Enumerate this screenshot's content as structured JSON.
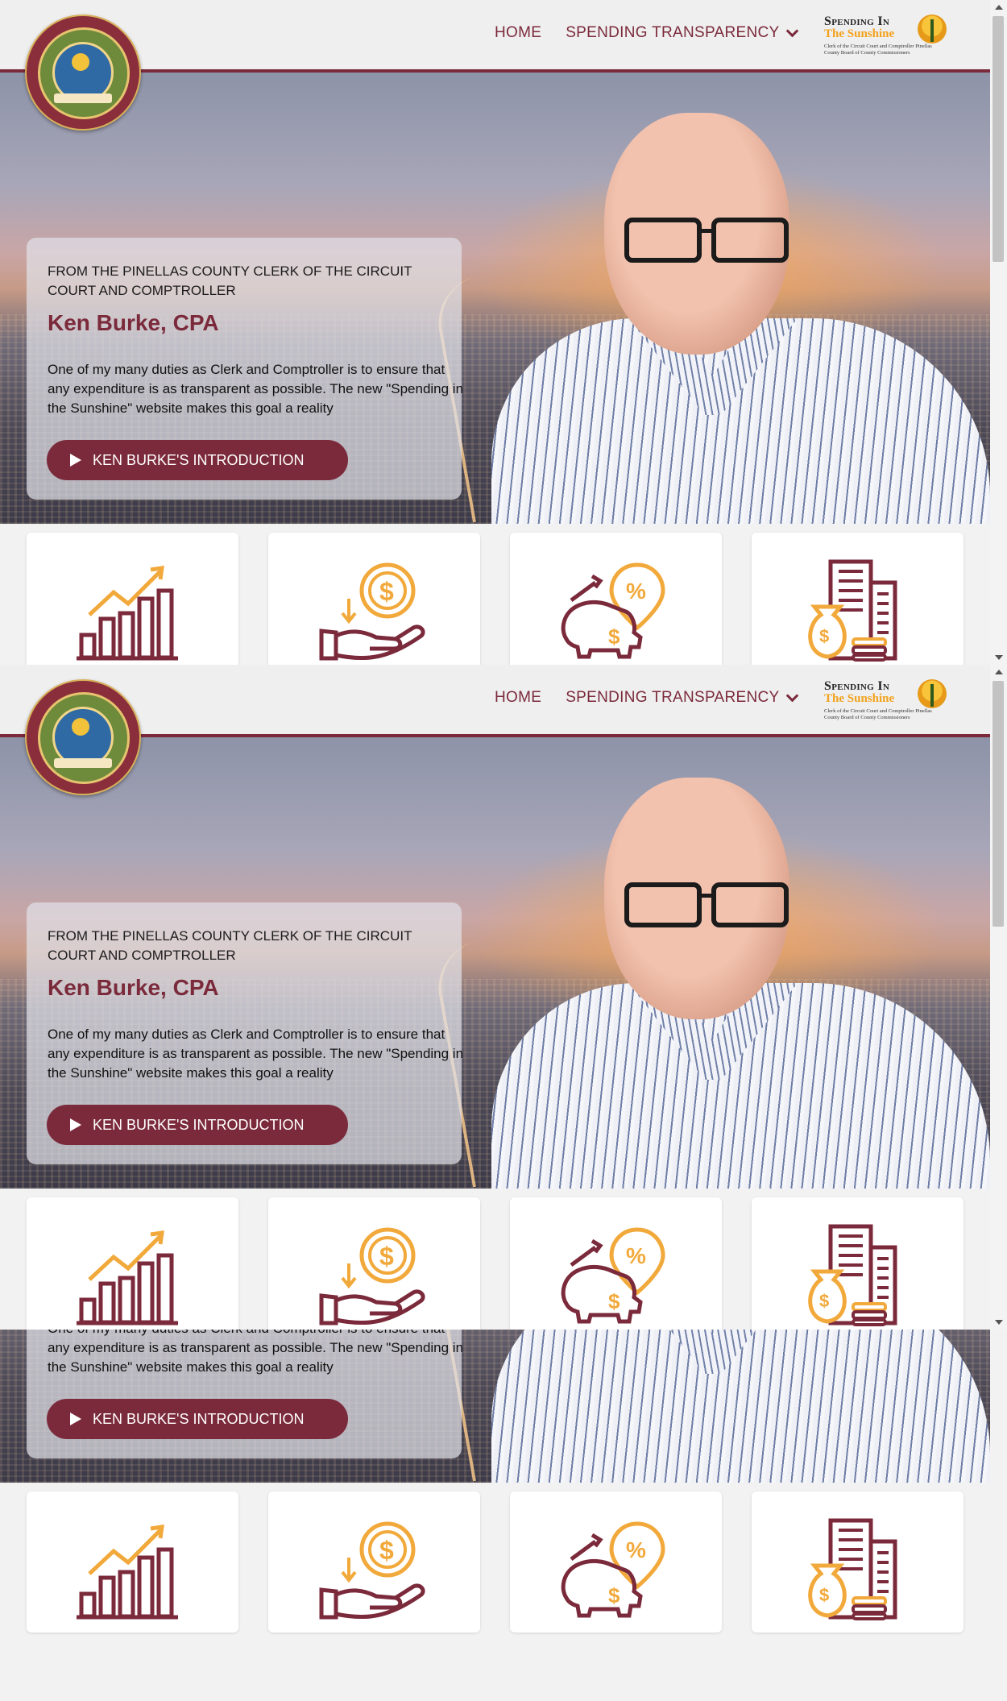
{
  "header": {
    "seal_alt": "Clerk of the Circuit Court & Comptroller Pinellas County, Florida",
    "nav": {
      "home": "HOME",
      "spending": "SPENDING TRANSPARENCY"
    },
    "brand": {
      "line1": "Spending In",
      "line2": "The Sunshine",
      "line3": "Clerk of the Circuit Court and Comptroller Pinellas County Board of County Commissioners"
    }
  },
  "hero": {
    "eyebrow": "FROM THE PINELLAS COUNTY CLERK OF THE CIRCUIT COURT AND COMPTROLLER",
    "name": "Ken Burke, CPA",
    "paragraph": "One of my many duties as Clerk and Comptroller is to ensure that any expenditure is as transparent as possible. The new \"Spending in the Sunshine\" website makes this goal a reality",
    "button": "KEN BURKE'S INTRODUCTION"
  },
  "tiles": [
    {
      "icon": "bar-chart-growth-icon"
    },
    {
      "icon": "dollar-hand-icon"
    },
    {
      "icon": "piggy-bank-percent-icon"
    },
    {
      "icon": "building-money-bag-icon"
    }
  ],
  "colors": {
    "brand": "#7b2a3b",
    "accent": "#f2a93b"
  }
}
